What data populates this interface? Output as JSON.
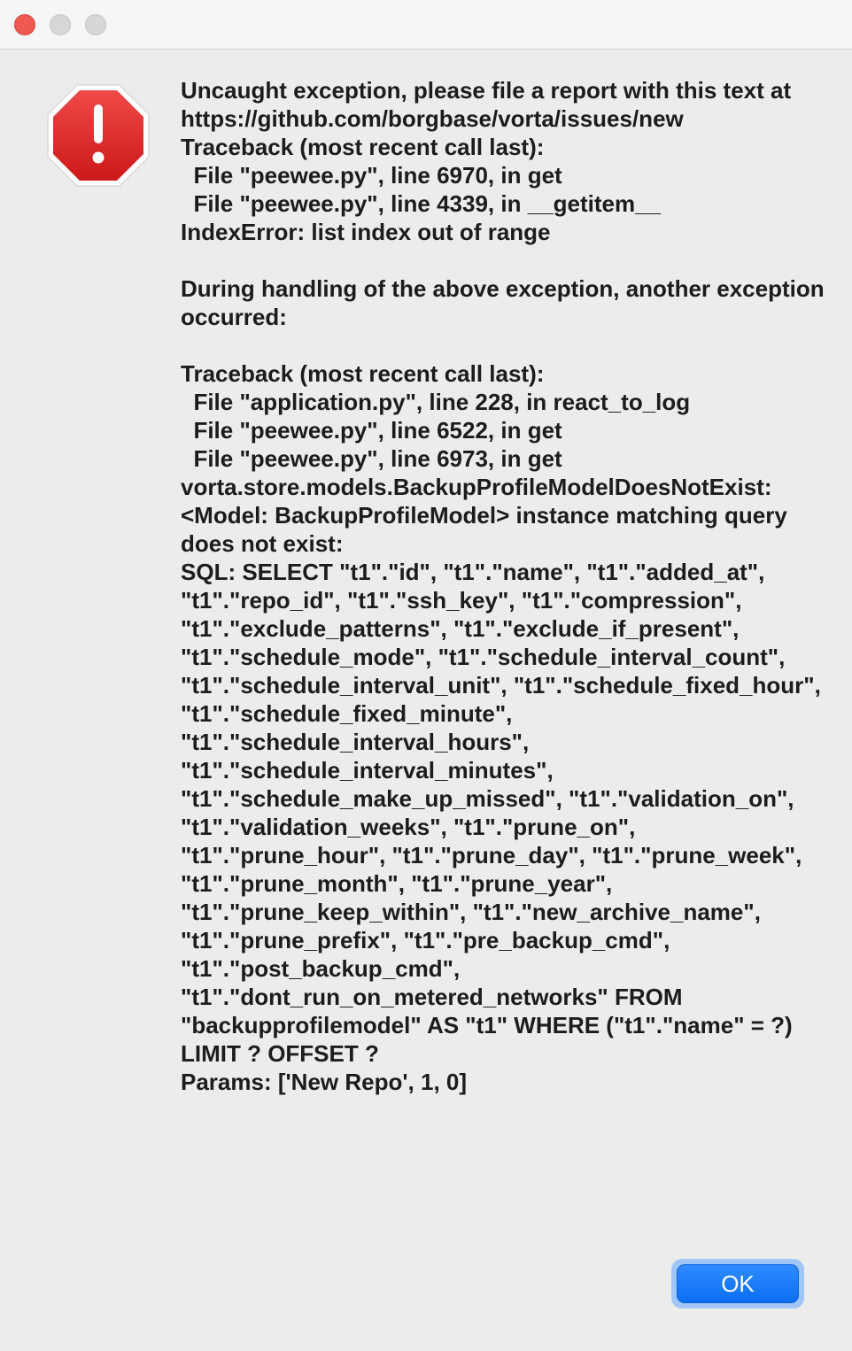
{
  "window": {
    "close_color": "#ee5a52",
    "inactive_button_color": "#d7d7d7"
  },
  "alert": {
    "icon": "stop-exclamation-icon",
    "icon_color": "#e02a2a",
    "message": "Uncaught exception, please file a report with this text at\nhttps://github.com/borgbase/vorta/issues/new\nTraceback (most recent call last):\n  File \"peewee.py\", line 6970, in get\n  File \"peewee.py\", line 4339, in __getitem__\nIndexError: list index out of range\n\nDuring handling of the above exception, another exception occurred:\n\nTraceback (most recent call last):\n  File \"application.py\", line 228, in react_to_log\n  File \"peewee.py\", line 6522, in get\n  File \"peewee.py\", line 6973, in get\nvorta.store.models.BackupProfileModelDoesNotExist: <Model: BackupProfileModel> instance matching query does not exist:\nSQL: SELECT \"t1\".\"id\", \"t1\".\"name\", \"t1\".\"added_at\", \"t1\".\"repo_id\", \"t1\".\"ssh_key\", \"t1\".\"compression\", \"t1\".\"exclude_patterns\", \"t1\".\"exclude_if_present\", \"t1\".\"schedule_mode\", \"t1\".\"schedule_interval_count\", \"t1\".\"schedule_interval_unit\", \"t1\".\"schedule_fixed_hour\", \"t1\".\"schedule_fixed_minute\", \"t1\".\"schedule_interval_hours\", \"t1\".\"schedule_interval_minutes\", \"t1\".\"schedule_make_up_missed\", \"t1\".\"validation_on\", \"t1\".\"validation_weeks\", \"t1\".\"prune_on\", \"t1\".\"prune_hour\", \"t1\".\"prune_day\", \"t1\".\"prune_week\", \"t1\".\"prune_month\", \"t1\".\"prune_year\", \"t1\".\"prune_keep_within\", \"t1\".\"new_archive_name\", \"t1\".\"prune_prefix\", \"t1\".\"pre_backup_cmd\", \"t1\".\"post_backup_cmd\", \"t1\".\"dont_run_on_metered_networks\" FROM \"backupprofilemodel\" AS \"t1\" WHERE (\"t1\".\"name\" = ?) LIMIT ? OFFSET ?\nParams: ['New Repo', 1, 0]"
  },
  "buttons": {
    "ok_label": "OK",
    "ok_color": "#0a6ff2"
  }
}
